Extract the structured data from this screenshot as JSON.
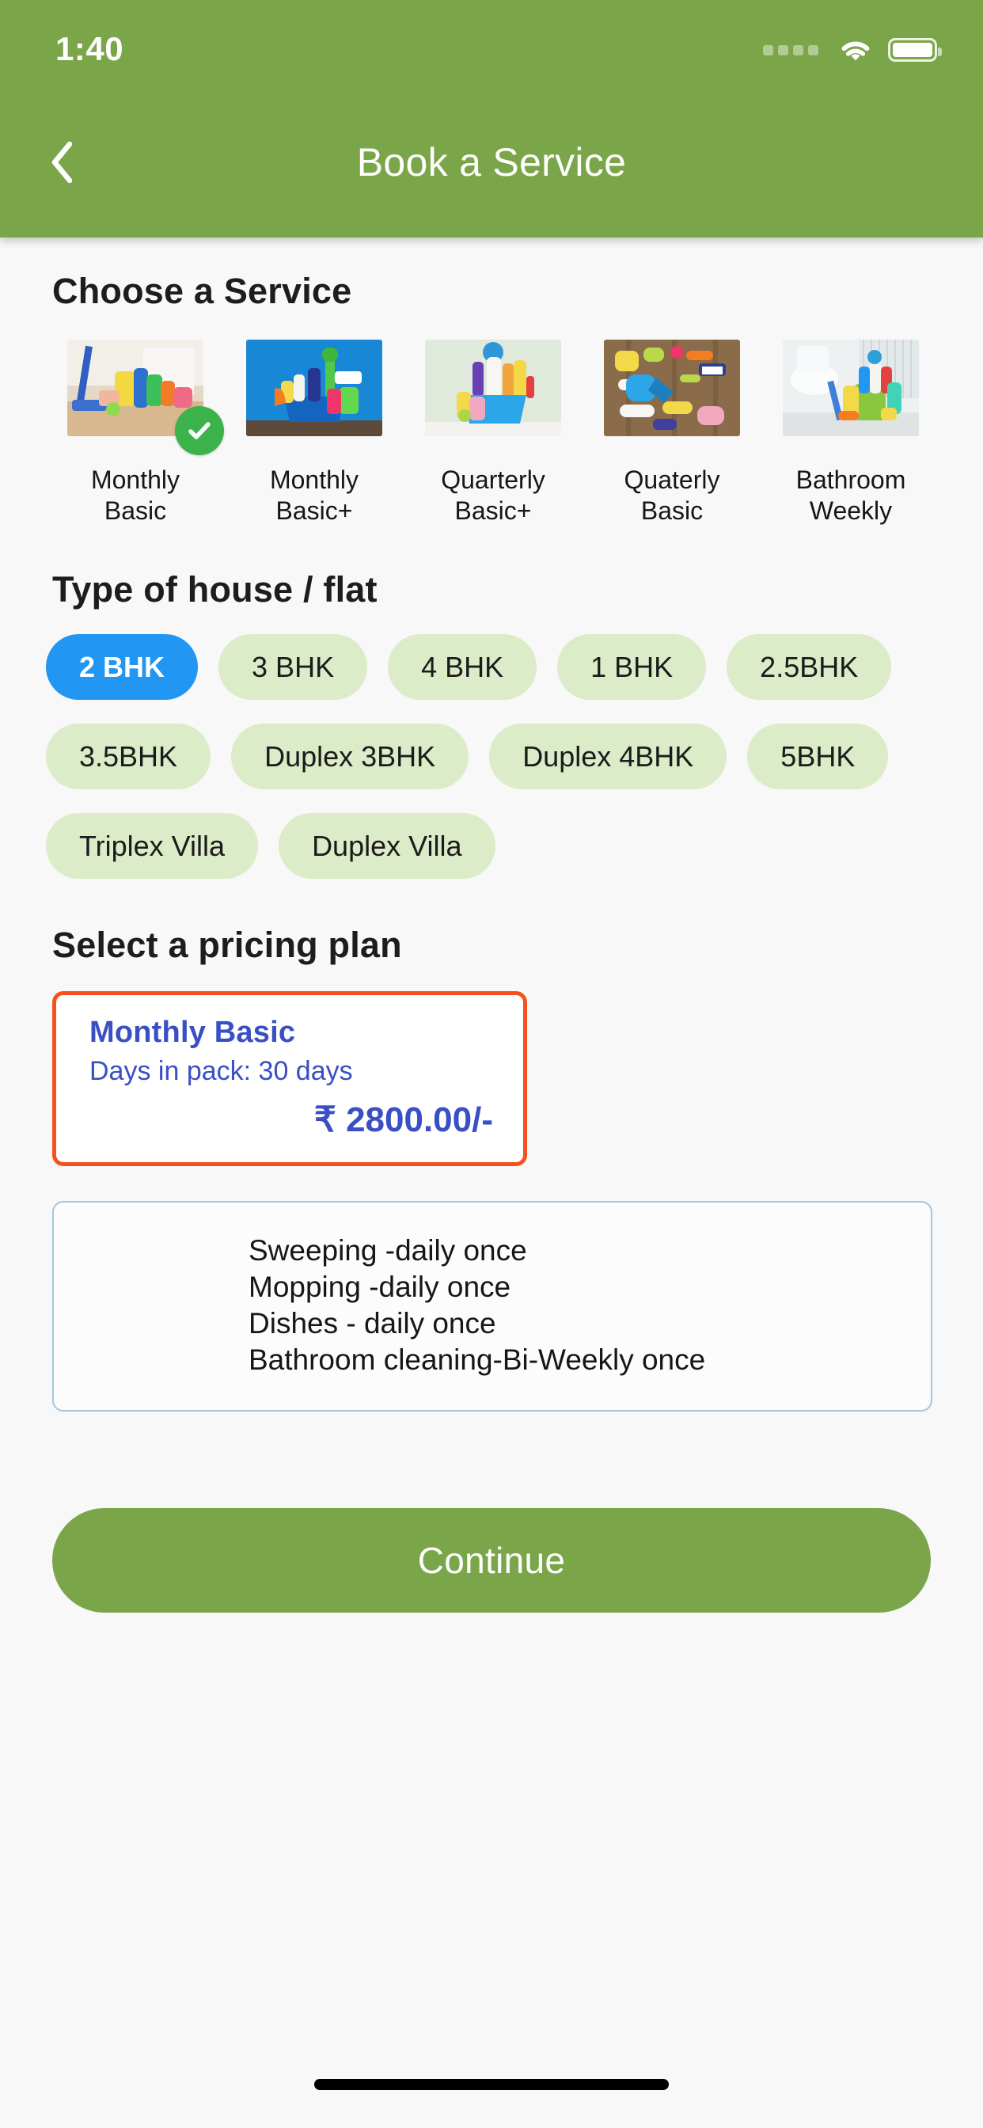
{
  "statusbar": {
    "time": "1:40",
    "signal_icon": "signal-dots-icon",
    "wifi_icon": "wifi-icon",
    "battery_icon": "battery-full-icon"
  },
  "header": {
    "title": "Book a Service",
    "back_icon": "chevron-left-icon",
    "background_color": "#7aa548"
  },
  "choose_service": {
    "title": "Choose a Service",
    "selected_index": 0,
    "check_icon": "check-circle-icon",
    "items": [
      {
        "label": "Monthly Basic",
        "line1": "Monthly",
        "line2": "Basic",
        "selected": true
      },
      {
        "label": "Monthly Basic+",
        "line1": "Monthly",
        "line2": "Basic+",
        "selected": false
      },
      {
        "label": "Quarterly Basic+",
        "line1": "Quarterly",
        "line2": "Basic+",
        "selected": false
      },
      {
        "label": "Quaterly Basic",
        "line1": "Quaterly",
        "line2": "Basic",
        "selected": false
      },
      {
        "label": "Bathroom Weekly",
        "line1": "Bathroom",
        "line2": "Weekly",
        "selected": false
      }
    ]
  },
  "house_type": {
    "title": "Type of house / flat",
    "selected": "2 BHK",
    "selected_color": "#2196f3",
    "chip_color": "#dcebc8",
    "options": [
      "2 BHK",
      "3 BHK",
      "4 BHK",
      "1 BHK",
      "2.5BHK",
      "3.5BHK",
      "Duplex 3BHK",
      "Duplex 4BHK",
      "5BHK",
      "Triplex Villa",
      "Duplex Villa"
    ]
  },
  "pricing": {
    "title": "Select a pricing plan",
    "border_color": "#f4511e",
    "text_color": "#3a4fc4",
    "plan": {
      "name": "Monthly Basic",
      "days": "Days in pack: 30 days",
      "amount": "₹ 2800.00/-"
    }
  },
  "details": {
    "border_color": "#a7c5dd",
    "lines": [
      "Sweeping -daily once",
      "Mopping -daily once",
      "Dishes - daily once",
      "Bathroom cleaning-Bi-Weekly once"
    ]
  },
  "footer": {
    "continue_label": "Continue",
    "continue_color": "#7aa548"
  }
}
